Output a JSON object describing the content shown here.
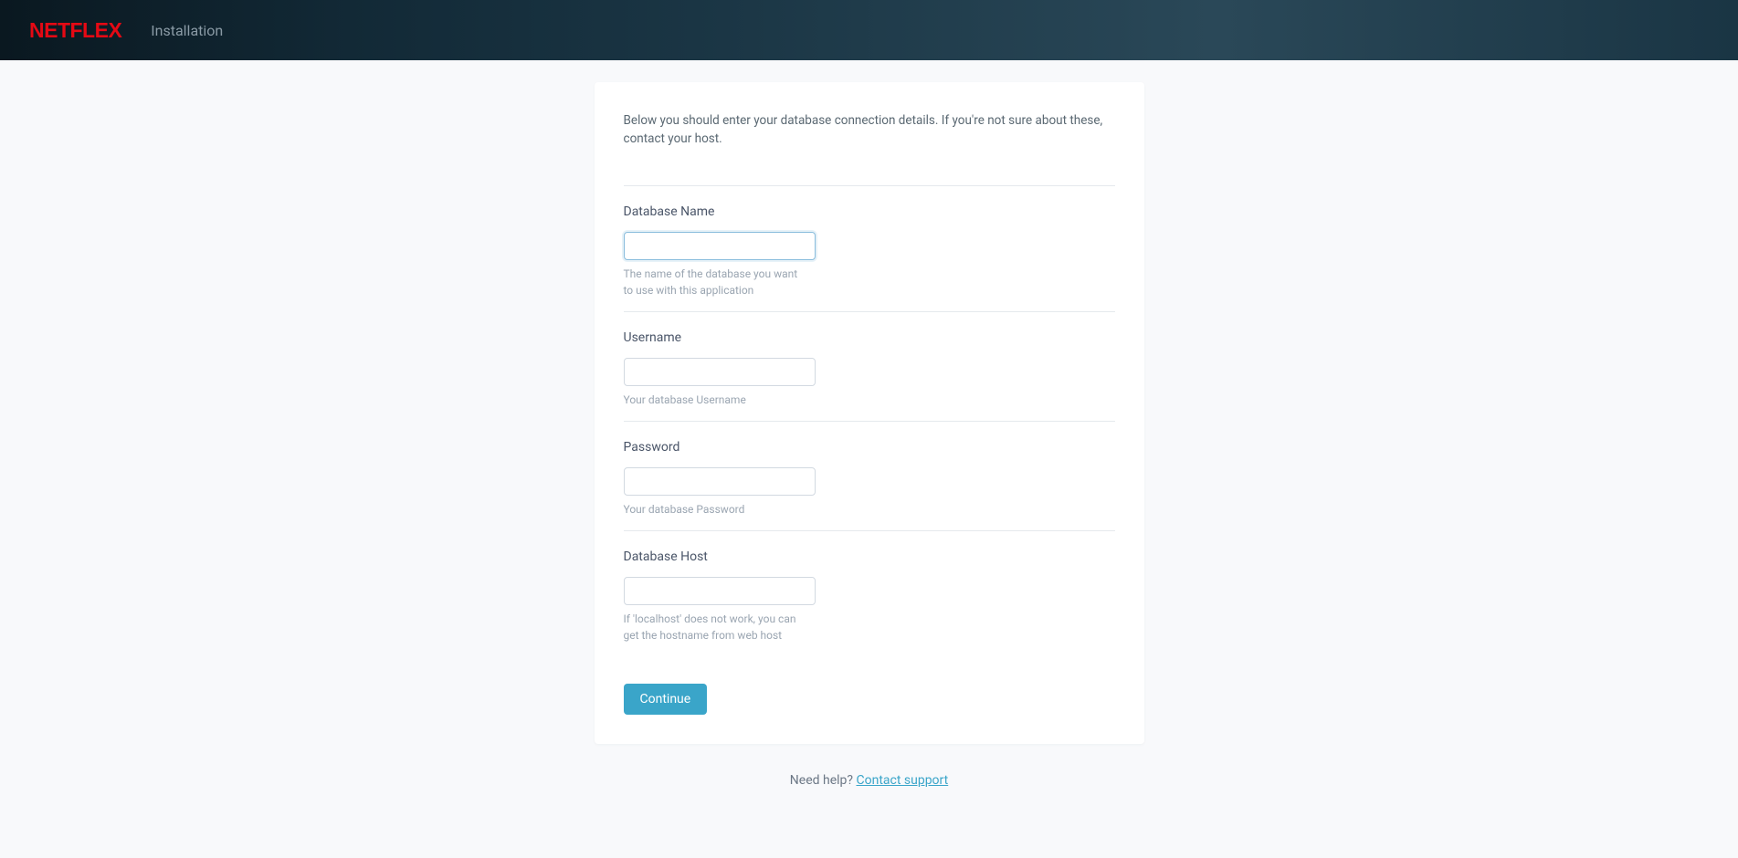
{
  "header": {
    "logo_text": "NETFLEX",
    "title": "Installation"
  },
  "intro": "Below you should enter your database connection details. If you're not sure about these, contact your host.",
  "fields": {
    "db_name": {
      "label": "Database Name",
      "value": "",
      "help": "The name of the database you want to use with this application"
    },
    "username": {
      "label": "Username",
      "value": "",
      "help": "Your database Username"
    },
    "password": {
      "label": "Password",
      "value": "",
      "help": "Your database Password"
    },
    "db_host": {
      "label": "Database Host",
      "value": "",
      "help": "If 'localhost' does not work, you can get the hostname from web host"
    }
  },
  "buttons": {
    "continue": "Continue"
  },
  "footer": {
    "text": "Need help? ",
    "link_text": "Contact support"
  }
}
